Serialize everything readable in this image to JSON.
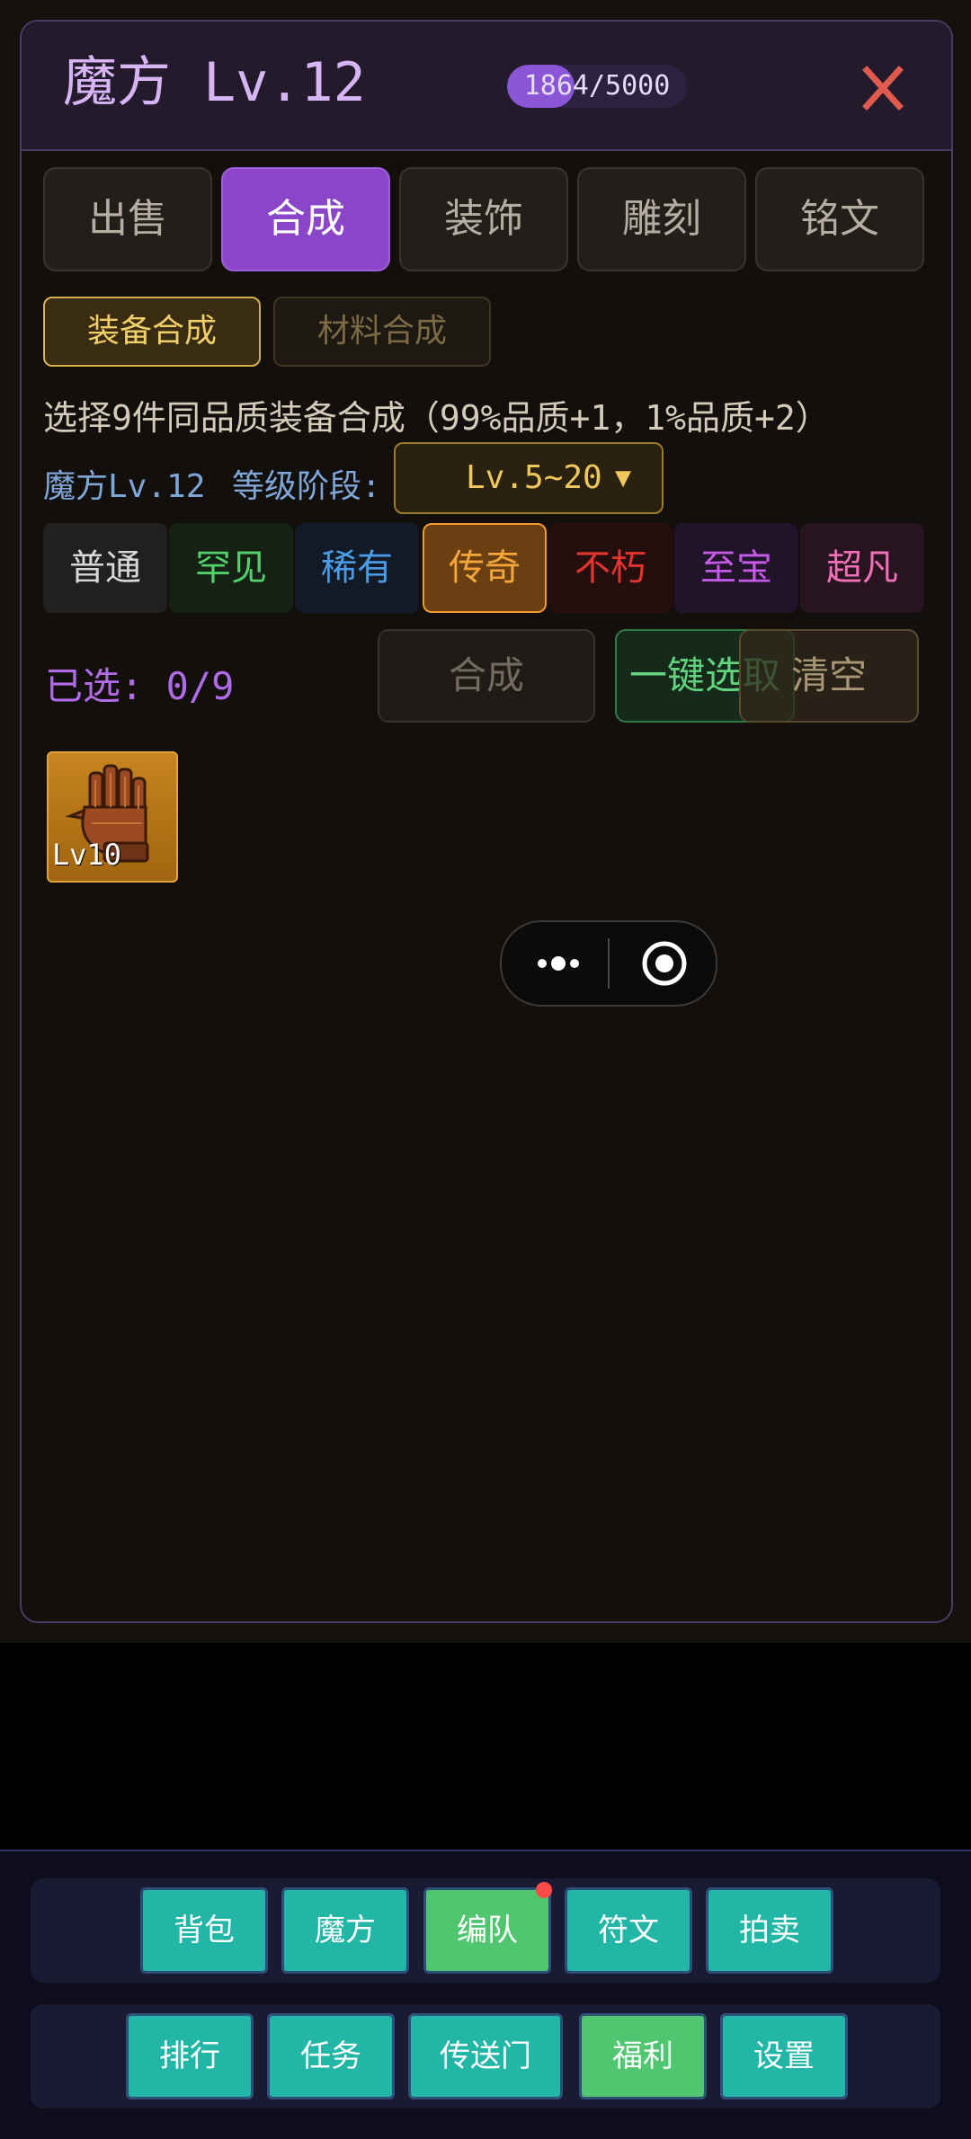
{
  "header": {
    "title": "魔方 Lv.12",
    "exp_text": "1864/5000",
    "exp_progress": 0.3728
  },
  "tabs": [
    "出售",
    "合成",
    "装饰",
    "雕刻",
    "铭文"
  ],
  "active_tab": "合成",
  "subtabs": [
    "装备合成",
    "材料合成"
  ],
  "description": "选择9件同品质装备合成（99%品质+1，1%品质+2）",
  "level_row": {
    "cube_level": "魔方Lv.12",
    "stage_label": "等级阶段:",
    "stage_value": "Lv.5~20",
    "caret": "▼"
  },
  "qualities": [
    {
      "label": "普通",
      "color": "#d8d8d8"
    },
    {
      "label": "罕见",
      "color": "#52d06a"
    },
    {
      "label": "稀有",
      "color": "#4a9ce8"
    },
    {
      "label": "传奇",
      "color": "#f19a27"
    },
    {
      "label": "不朽",
      "color": "#e6332f"
    },
    {
      "label": "至宝",
      "color": "#c45ae6"
    },
    {
      "label": "超凡",
      "color": "#f070b8"
    }
  ],
  "selection": {
    "selected_text": "已选: 0/9",
    "synthesize": "合成",
    "auto_select": "一键选取",
    "clear": "清空"
  },
  "item": {
    "level": "Lv10",
    "icon": "glove-icon"
  },
  "nav": {
    "row1": [
      "背包",
      "魔方",
      "编队",
      "符文",
      "拍卖"
    ],
    "row2": [
      "排行",
      "任务",
      "传送门",
      "福利",
      "设置"
    ]
  }
}
